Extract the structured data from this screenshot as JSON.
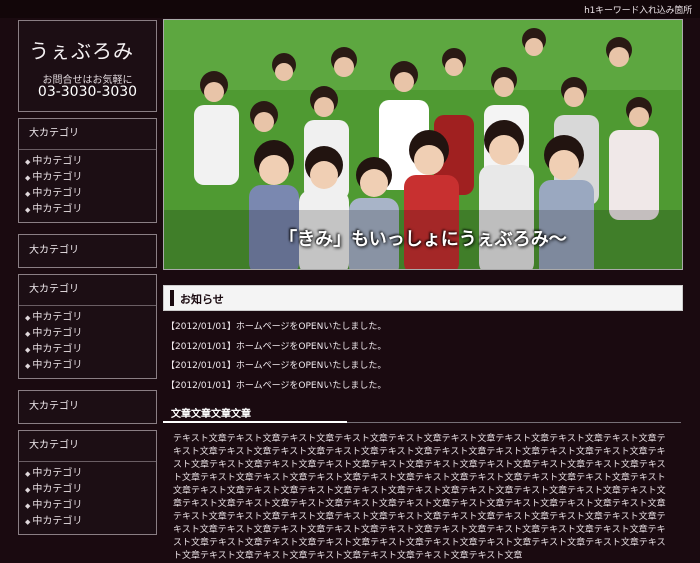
{
  "header": {
    "h1_text": "h1キーワード入れ込み箇所"
  },
  "logo": {
    "title": "うぇぶろみ",
    "contact": "お問合せはお気軽に",
    "phone": "03-3030-3030"
  },
  "sidebar": {
    "boxes": [
      {
        "heading": "大カテゴリ",
        "items": [
          "中カテゴリ",
          "中カテゴリ",
          "中カテゴリ",
          "中カテゴリ"
        ]
      },
      {
        "heading": "大カテゴリ",
        "items": []
      },
      {
        "heading": "大カテゴリ",
        "items": [
          "中カテゴリ",
          "中カテゴリ",
          "中カテゴリ",
          "中カテゴリ"
        ]
      },
      {
        "heading": "大カテゴリ",
        "items": []
      },
      {
        "heading": "大カテゴリ",
        "items": [
          "中カテゴリ",
          "中カテゴリ",
          "中カテゴリ",
          "中カテゴリ"
        ]
      }
    ]
  },
  "hero": {
    "caption": "「きみ」もいっしょにうぇぶろみ〜"
  },
  "news": {
    "heading": "お知らせ",
    "items": [
      "【2012/01/01】ホームページをOPENいたしました。",
      "【2012/01/01】ホームページをOPENいたしました。",
      "【2012/01/01】ホームページをOPENいたしました。",
      "【2012/01/01】ホームページをOPENいたしました。"
    ]
  },
  "section": {
    "title": "文章文章文章文章",
    "body": "テキスト文章テキスト文章テキスト文章テキスト文章テキスト文章テキスト文章テキスト文章テキスト文章テキスト文章テキスト文章テキスト文章テキスト文章テキスト文章テキスト文章テキスト文章テキスト文章テキスト文章テキスト文章テキスト文章テキスト文章テキスト文章テキスト文章テキスト文章テキスト文章テキスト文章テキスト文章テキスト文章テキスト文章テキスト文章テキスト文章テキスト文章テキスト文章テキスト文章テキスト文章テキスト文章テキスト文章テキスト文章テキスト文章テキスト文章テキスト文章テキスト文章テキスト文章テキスト文章テキスト文章テキスト文章テキスト文章テキスト文章テキスト文章テキスト文章テキスト文章テキスト文章テキスト文章テキスト文章テキスト文章テキスト文章テキスト文章テキスト文章テキスト文章テキスト文章テキスト文章テキスト文章テキスト文章テキスト文章テキスト文章テキスト文章テキスト文章テキスト文章テキスト文章テキスト文章テキスト文章テキスト文章テキスト文章テキスト文章テキスト文章テキスト文章テキスト文章テキスト文章テキスト文章テキスト文章テキスト文章テキスト文章テキスト文章テキスト文章テキスト文章テキスト文章テキスト文章テキスト文章テキスト文章テキスト文章"
  }
}
